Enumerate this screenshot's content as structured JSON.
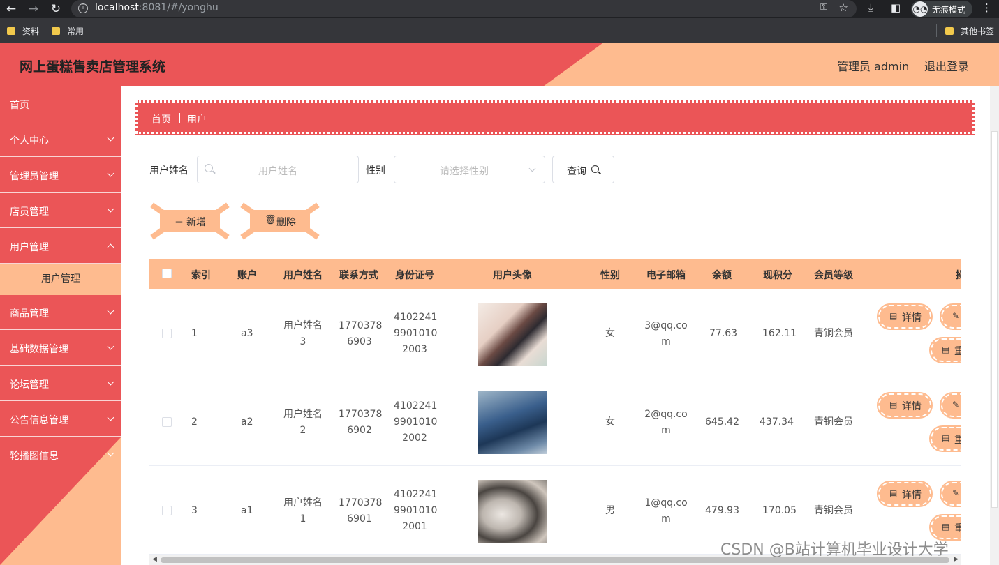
{
  "browser": {
    "url_host": "localhost",
    "url_rest": ":8081/#/yonghu",
    "incognito_label": "无痕模式",
    "bookmarks": [
      "资料",
      "常用"
    ],
    "other_bookmarks": "其他书签"
  },
  "header": {
    "title": "网上蛋糕售卖店管理系统",
    "admin_label": "管理员 admin",
    "logout_label": "退出登录",
    "colors": {
      "primary": "#eb5557",
      "accent": "#febb8f"
    }
  },
  "sidebar": {
    "items": [
      {
        "label": "首页",
        "has_chevron": false
      },
      {
        "label": "个人中心",
        "has_chevron": true
      },
      {
        "label": "管理员管理",
        "has_chevron": true
      },
      {
        "label": "店员管理",
        "has_chevron": true
      },
      {
        "label": "用户管理",
        "has_chevron": true
      },
      {
        "label": "商品管理",
        "has_chevron": true
      },
      {
        "label": "基础数据管理",
        "has_chevron": true
      },
      {
        "label": "论坛管理",
        "has_chevron": true
      },
      {
        "label": "公告信息管理",
        "has_chevron": true
      },
      {
        "label": "轮播图信息",
        "has_chevron": true
      }
    ],
    "active_sub": "用户管理"
  },
  "breadcrumb": {
    "home": "首页",
    "current": "用户"
  },
  "search": {
    "name_label": "用户姓名",
    "name_placeholder": "用户姓名",
    "gender_label": "性别",
    "gender_placeholder": "请选择性别",
    "query_label": "查询"
  },
  "actions": {
    "add_label": "新增",
    "delete_label": "删除"
  },
  "table": {
    "headers": [
      "索引",
      "账户",
      "用户姓名",
      "联系方式",
      "身份证号",
      "用户头像",
      "性别",
      "电子邮箱",
      "余额",
      "现积分",
      "会员等级",
      "操"
    ],
    "rows": [
      {
        "index": "1",
        "account": "a3",
        "name": [
          "用户姓名",
          "3"
        ],
        "phone": [
          "1770378",
          "6903"
        ],
        "id_card": [
          "4102241",
          "9901010",
          "2003"
        ],
        "gender": "女",
        "email": [
          "3@qq.co",
          "m"
        ],
        "balance": "77.63",
        "points": "162.11",
        "level": "青铜会员"
      },
      {
        "index": "2",
        "account": "a2",
        "name": [
          "用户姓名",
          "2"
        ],
        "phone": [
          "1770378",
          "6902"
        ],
        "id_card": [
          "4102241",
          "9901010",
          "2002"
        ],
        "gender": "女",
        "email": [
          "2@qq.co",
          "m"
        ],
        "balance": "645.42",
        "points": "437.34",
        "level": "青铜会员"
      },
      {
        "index": "3",
        "account": "a1",
        "name": [
          "用户姓名",
          "1"
        ],
        "phone": [
          "1770378",
          "6901"
        ],
        "id_card": [
          "4102241",
          "9901010",
          "2001"
        ],
        "gender": "男",
        "email": [
          "1@qq.co",
          "m"
        ],
        "balance": "479.93",
        "points": "170.05",
        "level": "青铜会员"
      }
    ],
    "op_labels": {
      "detail": "详情",
      "edit_clip": "",
      "reset_clip": "重"
    }
  },
  "watermark": "CSDN @B站计算机毕业设计大学"
}
